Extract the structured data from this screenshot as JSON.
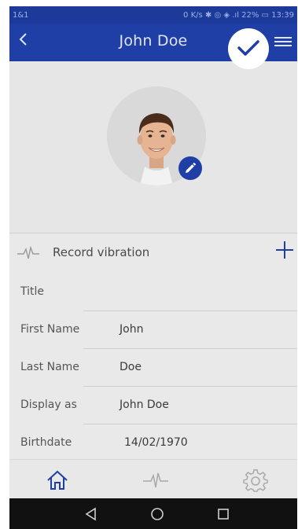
{
  "statusbar": {
    "left": "1&1",
    "right": "0 K/s ✱ ◎ ◈ .ıl 22% ▭ 13:39"
  },
  "header": {
    "title": "John Doe"
  },
  "record": {
    "label": "Record vibration"
  },
  "fields": [
    {
      "label": "Title",
      "value": ""
    },
    {
      "label": "First Name",
      "value": "John"
    },
    {
      "label": "Last Name",
      "value": "Doe"
    },
    {
      "label": "Display as",
      "value": "John Doe"
    },
    {
      "label": "Birthdate",
      "value": "14/02/1970"
    }
  ],
  "colors": {
    "accent": "#1f3fa6",
    "statusbar": "#1b3a9a"
  },
  "icons": {
    "back": "back-arrow-icon",
    "confirm": "checkmark-icon",
    "menu": "hamburger-menu-icon",
    "edit": "pencil-icon",
    "record": "waveform-icon",
    "add": "plus-icon",
    "nav_home": "home-icon",
    "nav_activity": "waveform-icon",
    "nav_settings": "gear-icon"
  }
}
